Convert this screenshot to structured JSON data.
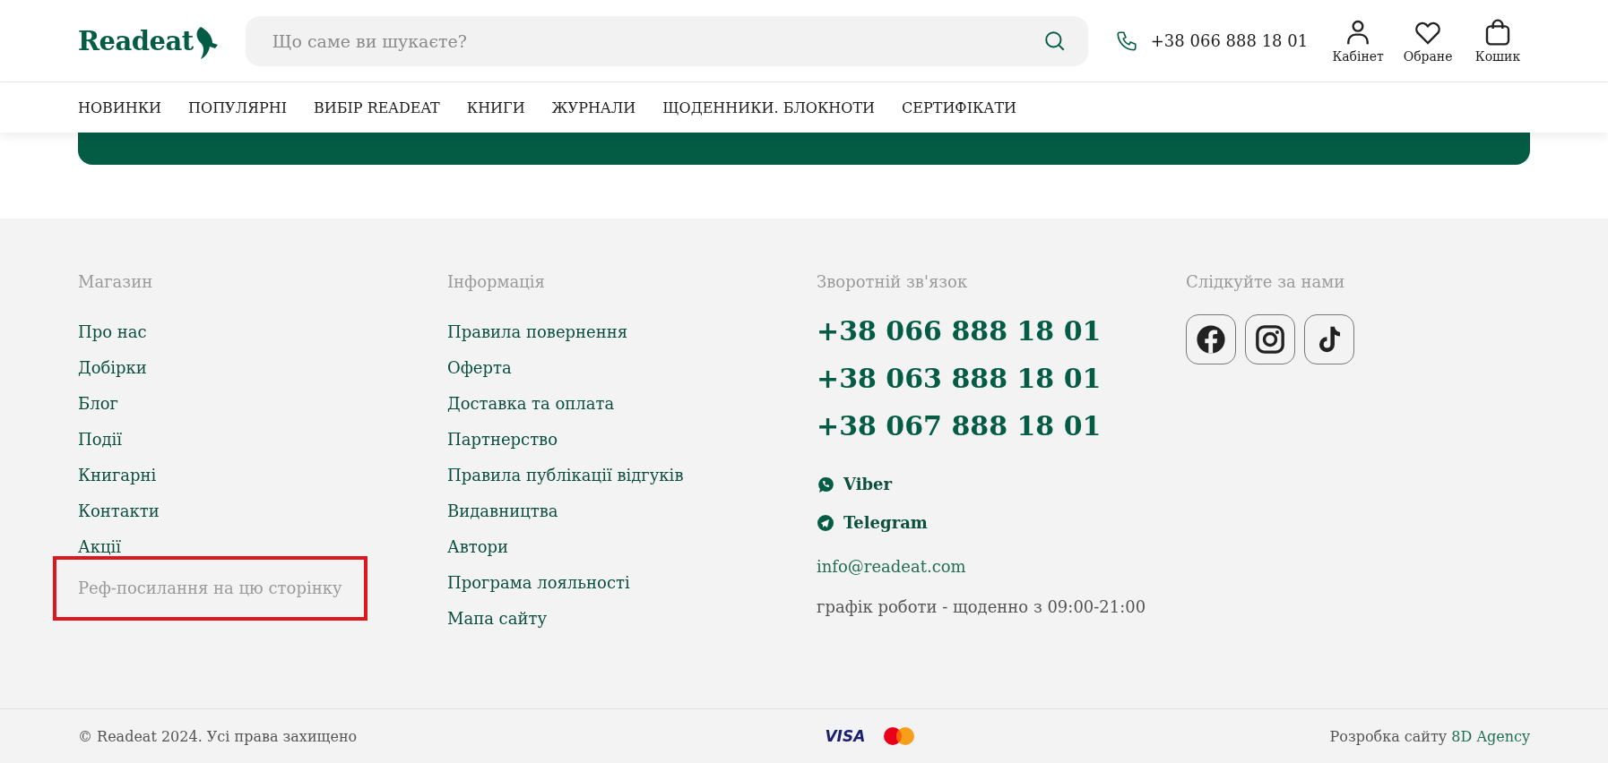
{
  "header": {
    "logo": "Readeat",
    "search": {
      "placeholder": "Що саме ви шукаєте?"
    },
    "phone": "+38 066 888 18 01",
    "actions": [
      {
        "kind": "account",
        "label": "Кабінет"
      },
      {
        "kind": "favorites",
        "label": "Обране"
      },
      {
        "kind": "cart",
        "label": "Кошик"
      }
    ]
  },
  "nav": {
    "items": [
      "НОВИНКИ",
      "ПОПУЛЯРНІ",
      "ВИБІР READEAT",
      "КНИГИ",
      "ЖУРНАЛИ",
      "ЩОДЕННИКИ. БЛОКНОТИ",
      "СЕРТИФІКАТИ"
    ]
  },
  "footer": {
    "columns": [
      {
        "kind": "links",
        "title": "Магазин",
        "items": [
          {
            "label": "Про нас",
            "disabled": false,
            "highlighted": false
          },
          {
            "label": "Добірки",
            "disabled": false,
            "highlighted": false
          },
          {
            "label": "Блог",
            "disabled": false,
            "highlighted": false
          },
          {
            "label": "Події",
            "disabled": false,
            "highlighted": false
          },
          {
            "label": "Книгарні",
            "disabled": false,
            "highlighted": false
          },
          {
            "label": "Контакти",
            "disabled": false,
            "highlighted": false
          },
          {
            "label": "Акції",
            "disabled": false,
            "highlighted": false
          },
          {
            "label": "Реф-посилання на цю сторінку",
            "disabled": true,
            "highlighted": true
          }
        ]
      },
      {
        "kind": "links",
        "title": "Інформація",
        "items": [
          {
            "label": "Правила повернення",
            "disabled": false,
            "highlighted": false
          },
          {
            "label": "Оферта",
            "disabled": false,
            "highlighted": false
          },
          {
            "label": "Доставка та оплата",
            "disabled": false,
            "highlighted": false
          },
          {
            "label": "Партнерство",
            "disabled": false,
            "highlighted": false
          },
          {
            "label": "Правила публікації відгуків",
            "disabled": false,
            "highlighted": false
          },
          {
            "label": "Видавництва",
            "disabled": false,
            "highlighted": false
          },
          {
            "label": "Автори",
            "disabled": false,
            "highlighted": false
          },
          {
            "label": "Програма лояльності",
            "disabled": false,
            "highlighted": false
          },
          {
            "label": "Мапа сайту",
            "disabled": false,
            "highlighted": false
          }
        ]
      },
      {
        "kind": "contacts",
        "title": "Зворотній зв'язок",
        "phones": [
          "+38 066 888 18 01",
          "+38 063 888 18 01",
          "+38 067 888 18 01"
        ],
        "messengers": [
          {
            "kind": "viber",
            "label": "Viber"
          },
          {
            "kind": "telegram",
            "label": "Telegram"
          }
        ],
        "email": "info@readeat.com",
        "hours": "графік роботи - щоденно з 09:00-21:00"
      },
      {
        "kind": "social",
        "title": "Слідкуйте за нами",
        "networks": [
          {
            "kind": "facebook"
          },
          {
            "kind": "instagram"
          },
          {
            "kind": "tiktok"
          }
        ]
      }
    ],
    "bottom": {
      "copyright": "© Readeat 2024. Усі права захищено",
      "payments": [
        {
          "kind": "visa",
          "label": "VISA"
        },
        {
          "kind": "mastercard"
        }
      ],
      "credit": "Розробка сайту",
      "agency": "8D Agency"
    }
  }
}
